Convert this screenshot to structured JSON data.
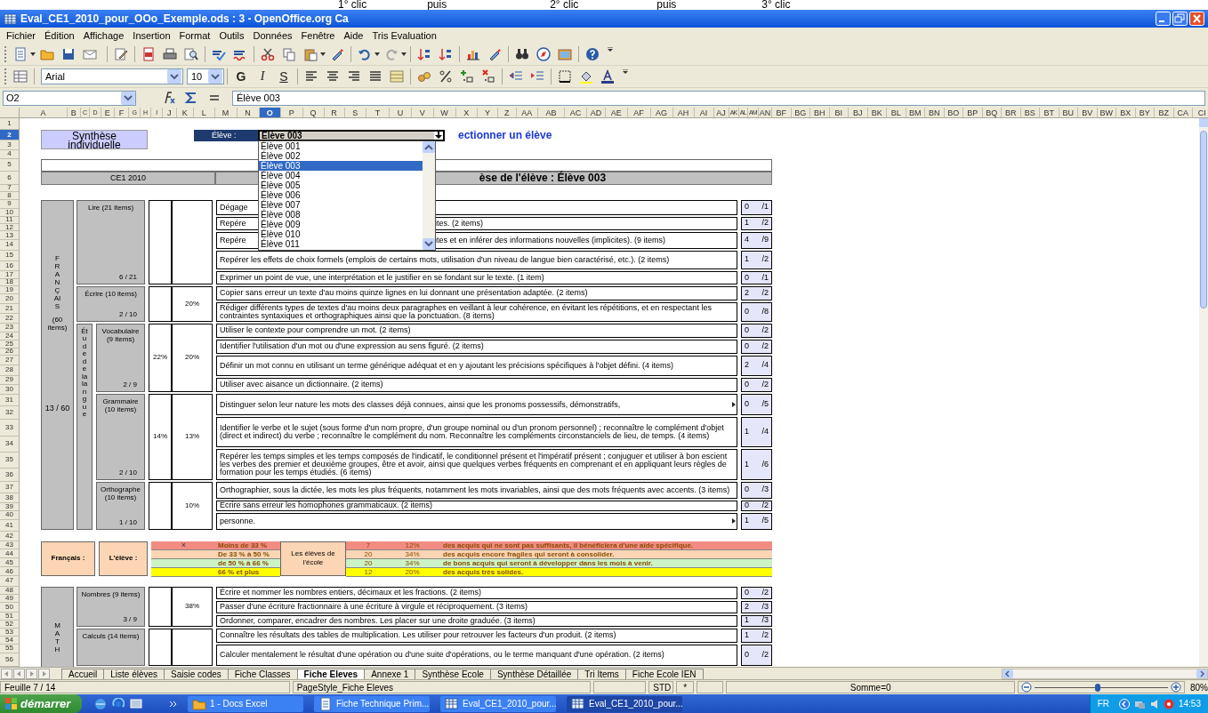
{
  "annotations": [
    "1° clic",
    "puis",
    "2° clic",
    "puis",
    "3° clic"
  ],
  "window": {
    "title": "Eval_CE1_2010_pour_OOo_Exemple.ods : 3 - OpenOffice.org Ca"
  },
  "menu": [
    "Fichier",
    "Édition",
    "Affichage",
    "Insertion",
    "Format",
    "Outils",
    "Données",
    "Fenêtre",
    "Aide",
    "Tris Evaluation"
  ],
  "format_toolbar": {
    "font_name": "Arial",
    "font_size": "10",
    "style_buttons": [
      "G",
      "I",
      "S"
    ]
  },
  "formula_bar": {
    "cell_ref": "O2",
    "content": "Élève 003"
  },
  "columns": [
    {
      "label": "A",
      "selected": false
    },
    {
      "label": "B",
      "selected": false
    },
    {
      "label": "C",
      "selected": false
    },
    {
      "label": "D",
      "selected": false
    },
    {
      "label": "E",
      "selected": false
    },
    {
      "label": "F",
      "selected": false
    },
    {
      "label": "G",
      "selected": false
    },
    {
      "label": "H",
      "selected": false
    },
    {
      "label": "I",
      "selected": false
    },
    {
      "label": "J",
      "selected": false
    },
    {
      "label": "K",
      "selected": false
    },
    {
      "label": "L",
      "selected": false
    },
    {
      "label": "M",
      "selected": false
    },
    {
      "label": "N",
      "selected": false
    },
    {
      "label": "O",
      "selected": true
    },
    {
      "label": "P",
      "selected": false
    },
    {
      "label": "Q",
      "selected": false
    },
    {
      "label": "R",
      "selected": false
    },
    {
      "label": "S",
      "selected": false
    },
    {
      "label": "T",
      "selected": false
    },
    {
      "label": "U",
      "selected": false
    },
    {
      "label": "V",
      "selected": false
    },
    {
      "label": "W",
      "selected": false
    },
    {
      "label": "X",
      "selected": false
    },
    {
      "label": "Y",
      "selected": false
    },
    {
      "label": "Z",
      "selected": false
    },
    {
      "label": "AA",
      "selected": false
    },
    {
      "label": "AB",
      "selected": false
    },
    {
      "label": "AC",
      "selected": false
    },
    {
      "label": "AD",
      "selected": false
    },
    {
      "label": "AE",
      "selected": false
    },
    {
      "label": "AF",
      "selected": false
    },
    {
      "label": "AG",
      "selected": false
    },
    {
      "label": "AH",
      "selected": false
    },
    {
      "label": "AI",
      "selected": false
    },
    {
      "label": "AJ",
      "selected": false
    },
    {
      "label": "AK",
      "selected": false
    },
    {
      "label": "AL",
      "selected": false
    },
    {
      "label": "AM",
      "selected": false
    },
    {
      "label": "AN",
      "selected": false
    },
    {
      "label": "BF",
      "selected": false
    },
    {
      "label": "BG",
      "selected": false
    },
    {
      "label": "BH",
      "selected": false
    },
    {
      "label": "BI",
      "selected": false
    },
    {
      "label": "BJ",
      "selected": false
    },
    {
      "label": "BK",
      "selected": false
    },
    {
      "label": "BL",
      "selected": false
    },
    {
      "label": "BM",
      "selected": false
    },
    {
      "label": "BN",
      "selected": false
    },
    {
      "label": "BO",
      "selected": false
    },
    {
      "label": "BP",
      "selected": false
    },
    {
      "label": "BQ",
      "selected": false
    },
    {
      "label": "BR",
      "selected": false
    },
    {
      "label": "BS",
      "selected": false
    },
    {
      "label": "BT",
      "selected": false
    },
    {
      "label": "BU",
      "selected": false
    },
    {
      "label": "BV",
      "selected": false
    },
    {
      "label": "BW",
      "selected": false
    },
    {
      "label": "BX",
      "selected": false
    },
    {
      "label": "BY",
      "selected": false
    },
    {
      "label": "BZ",
      "selected": false
    },
    {
      "label": "CA",
      "selected": false
    },
    {
      "label": "CI",
      "selected": false
    }
  ],
  "rows": [
    {
      "label": "1",
      "selected": false
    },
    {
      "label": "2",
      "selected": true
    },
    {
      "label": "3",
      "selected": false
    },
    {
      "label": "4",
      "selected": false
    },
    {
      "label": "5",
      "selected": false
    },
    {
      "label": "6",
      "selected": false
    },
    {
      "label": "7",
      "selected": false
    },
    {
      "label": "8",
      "selected": false
    },
    {
      "label": "9",
      "selected": false
    },
    {
      "label": "10",
      "selected": false
    },
    {
      "label": "11",
      "selected": false
    },
    {
      "label": "12",
      "selected": false
    },
    {
      "label": "13",
      "selected": false
    },
    {
      "label": "14",
      "selected": false
    },
    {
      "label": "15",
      "selected": false
    },
    {
      "label": "16",
      "selected": false
    },
    {
      "label": "17",
      "selected": false
    },
    {
      "label": "18",
      "selected": false
    },
    {
      "label": "19",
      "selected": false
    },
    {
      "label": "20",
      "selected": false
    },
    {
      "label": "21",
      "selected": false
    },
    {
      "label": "22",
      "selected": false
    },
    {
      "label": "23",
      "selected": false
    },
    {
      "label": "24",
      "selected": false
    },
    {
      "label": "25",
      "selected": false
    },
    {
      "label": "26",
      "selected": false
    },
    {
      "label": "27",
      "selected": false
    },
    {
      "label": "28",
      "selected": false
    },
    {
      "label": "29",
      "selected": false
    },
    {
      "label": "30",
      "selected": false
    },
    {
      "label": "31",
      "selected": false
    },
    {
      "label": "32",
      "selected": false
    },
    {
      "label": "33",
      "selected": false
    },
    {
      "label": "34",
      "selected": false
    },
    {
      "label": "35",
      "selected": false
    },
    {
      "label": "36",
      "selected": false
    },
    {
      "label": "37",
      "selected": false
    },
    {
      "label": "38",
      "selected": false
    },
    {
      "label": "39",
      "selected": false
    },
    {
      "label": "40",
      "selected": false
    },
    {
      "label": "41",
      "selected": false
    },
    {
      "label": "42",
      "selected": false
    },
    {
      "label": "43",
      "selected": false
    },
    {
      "label": "44",
      "selected": false
    },
    {
      "label": "45",
      "selected": false
    },
    {
      "label": "46",
      "selected": false
    },
    {
      "label": "47",
      "selected": false
    },
    {
      "label": "48",
      "selected": false
    },
    {
      "label": "49",
      "selected": false
    },
    {
      "label": "50",
      "selected": false
    },
    {
      "label": "51",
      "selected": false
    },
    {
      "label": "52",
      "selected": false
    },
    {
      "label": "53",
      "selected": false
    },
    {
      "label": "54",
      "selected": false
    },
    {
      "label": "55",
      "selected": false
    },
    {
      "label": "56",
      "selected": false
    }
  ],
  "sheet": {
    "header": {
      "title": "Synthèse individuelle",
      "student_label": "Élève :",
      "student_value": "Élève 003",
      "hint": "ectionner un élève",
      "class_label": "CE1 2010",
      "synthesis_title": "èse de l'élève : Élève 003"
    },
    "dropdown": {
      "options": [
        {
          "label": "Élève 001",
          "selected": false
        },
        {
          "label": "Élève 002",
          "selected": false
        },
        {
          "label": "Élève 003",
          "selected": true
        },
        {
          "label": "Élève 004",
          "selected": false
        },
        {
          "label": "Élève 005",
          "selected": false
        },
        {
          "label": "Élève 006",
          "selected": false
        },
        {
          "label": "Élève 007",
          "selected": false
        },
        {
          "label": "Élève 008",
          "selected": false
        },
        {
          "label": "Élève 009",
          "selected": false
        },
        {
          "label": "Élève 010",
          "selected": false
        },
        {
          "label": "Élève 011",
          "selected": false
        }
      ]
    },
    "francais": {
      "name": "FRANÇAIS",
      "count": "(60 items)",
      "score": "13 / 60",
      "groups": [
        {
          "kind": "group",
          "name": "Lire (21 items)",
          "score": "6 / 21",
          "items": [
            {
              "text": "Dégage",
              "score": "0",
              "max": "/1",
              "clipped": false
            },
            {
              "text": "Repére",
              "text_after": "ites. (2 items)",
              "score": "1",
              "max": "/2",
              "clipped": false
            },
            {
              "text": "Repére",
              "text_after": "ites et en inférer des informations nouvelles (implicites). (9 items)",
              "score": "4",
              "max": "/9",
              "clipped": false
            },
            {
              "text": "Repérer les effets de choix formels (emplois de certains mots, utilisation d'un niveau de langue bien caractérisé, etc.). (2 items)",
              "score": "1",
              "max": "/2",
              "clipped": false
            },
            {
              "text": "Exprimer un point de vue, une interprétation et le justifier en se fondant sur le texte. (1 item)",
              "score": "0",
              "max": "/1",
              "clipped": false
            }
          ]
        },
        {
          "kind": "group",
          "name": "Écrire (10 items)",
          "score": "2 / 10",
          "pct": "20%",
          "items": [
            {
              "text": "Copier sans erreur un texte d'au moins quinze lignes en lui donnant une présentation adaptée. (2 items)",
              "score": "2",
              "max": "/2",
              "clipped": false
            },
            {
              "text": "Rédiger différents types de textes d'au moins deux paragraphes en veillant à leur cohérence, en évitant les répétitions, et en respectant les contraintes syntaxiques et orthographiques ainsi que la ponctuation. (8 items)",
              "score": "0",
              "max": "/8",
              "clipped": false
            }
          ]
        },
        {
          "kind": "section",
          "name": "Étude de la langue",
          "subgroups": [
            {
              "name": "Vocabulaire (9 items)",
              "score": "2 / 9",
              "pct_outer": "22%",
              "pct": "20%",
              "items": [
                {
                  "text": "Utiliser le contexte pour comprendre un mot. (2 items)",
                  "score": "0",
                  "max": "/2",
                  "clipped": false
                },
                {
                  "text": "Identifier l'utilisation d'un mot ou d'une expression au sens figuré. (2 items)",
                  "score": "0",
                  "max": "/2",
                  "clipped": false
                },
                {
                  "text": "Définir un mot connu en utilisant un terme générique adéquat et en y ajoutant les précisions spécifiques à l'objet défini. (4 items)",
                  "score": "2",
                  "max": "/4",
                  "clipped": false
                },
                {
                  "text": "Utiliser avec aisance un dictionnaire. (2 items)",
                  "score": "0",
                  "max": "/2",
                  "clipped": false
                }
              ]
            },
            {
              "name": "Grammaire (10 items)",
              "score": "2 / 10",
              "pct_outer": "14%",
              "pct": "13%",
              "items": [
                {
                  "text": "Distinguer selon leur nature les mots des classes déjà connues, ainsi que les pronoms possessifs, démonstratifs,",
                  "score": "0",
                  "max": "/5",
                  "clipped": true
                },
                {
                  "text": "Identifier le verbe et le sujet (sous forme d'un nom propre, d'un groupe nominal ou d'un pronom personnel) ; reconnaître le complément d'objet (direct et indirect) du verbe ; reconnaître le complément du nom. Reconnaître les compléments circonstanciels de lieu, de temps. (4 items)",
                  "score": "1",
                  "max": "/4",
                  "clipped": false
                },
                {
                  "text": "Repérer les temps simples et les temps composés de l'indicatif, le conditionnel présent et l'impératif présent ; conjuguer et utiliser à bon escient les verbes des premier et deuxième groupes, être et avoir, ainsi que quelques verbes fréquents en comprenant et en appliquant leurs règles de formation pour les temps étudiés. (6 items)",
                  "score": "1",
                  "max": "/6",
                  "clipped": false
                }
              ]
            },
            {
              "name": "Orthographe (10 items)",
              "score": "1 / 10",
              "pct": "10%",
              "items": [
                {
                  "text": "Orthographier, sous la dictée, les mots les plus fréquents, notamment les mots invariables, ainsi que des mots fréquents avec accents. (3 items)",
                  "score": "0",
                  "max": "/3",
                  "clipped": false
                },
                {
                  "text": "Écrire sans erreur les homophones grammaticaux. (2 items)",
                  "score": "0",
                  "max": "/2",
                  "clipped": false
                },
                {
                  "text": "personne.",
                  "score": "1",
                  "max": "/5",
                  "clipped": true
                }
              ]
            }
          ]
        }
      ]
    },
    "legend": {
      "domain": "Français :",
      "student": "L'élève :",
      "marker": "×",
      "school": "Les élèves de l'école",
      "levels": [
        {
          "range": "Moins de 33 %",
          "count": "7",
          "pct": "12%",
          "text": "des acquis qui ne sont pas suffisants, il bénéficiera d'une aide spécifique.",
          "color": "#f28b82",
          "selected": true
        },
        {
          "range": "De 33 % à 50 %",
          "count": "20",
          "pct": "34%",
          "text": "des acquis encore fragiles qui seront à consolider.",
          "color": "#fcd5b4",
          "selected": false
        },
        {
          "range": "de 50 % à 66 %",
          "count": "20",
          "pct": "34%",
          "text": "de bons acquis qui seront à développer dans les mois à venir.",
          "color": "#ccf2c6",
          "selected": false
        },
        {
          "range": "66 % et plus",
          "count": "12",
          "pct": "20%",
          "text": "des acquis très solides.",
          "color": "#ffff00",
          "selected": false
        }
      ]
    },
    "maths": {
      "name": "MATH",
      "groups": [
        {
          "kind": "group",
          "name": "Nombres (9 items)",
          "score": "3 / 9",
          "pct": "38%",
          "items": [
            {
              "text": "Écrire et nommer les nombres entiers, décimaux et les fractions. (2 items)",
              "score": "0",
              "max": "/2",
              "clipped": false
            },
            {
              "text": "Passer d'une écriture fractionnaire à une écriture à virgule et réciproquement. (3 items)",
              "score": "2",
              "max": "/3",
              "clipped": false
            },
            {
              "text": "Ordonner, comparer, encadrer des nombres. Les placer sur une droite graduée. (3 items)",
              "score": "1",
              "max": "/3",
              "clipped": false
            }
          ]
        },
        {
          "kind": "group",
          "name": "Calculs (14 items)",
          "items": [
            {
              "text": "Connaître les résultats des tables de multiplication. Les utiliser pour retrouver les facteurs d'un produit. (2 items)",
              "score": "1",
              "max": "/2",
              "clipped": false
            },
            {
              "text": "Calculer mentalement le résultat d'une opération ou d'une suite d'opérations, ou le terme manquant d'une opération. (2 items)",
              "score": "0",
              "max": "/2",
              "clipped": false
            }
          ]
        }
      ]
    }
  },
  "sheet_tabs": [
    {
      "label": "Accueil",
      "selected": false
    },
    {
      "label": "Liste élèves",
      "selected": false
    },
    {
      "label": "Saisie codes",
      "selected": false
    },
    {
      "label": "Fiche Classes",
      "selected": false
    },
    {
      "label": "Fiche Eleves",
      "selected": true
    },
    {
      "label": "Annexe 1",
      "selected": false
    },
    {
      "label": "Synthèse Ecole",
      "selected": false
    },
    {
      "label": "Synthèse Détaillée",
      "selected": false
    },
    {
      "label": "Tri Items",
      "selected": false
    },
    {
      "label": "Fiche Ecole IEN",
      "selected": false
    }
  ],
  "status_bar": {
    "sheet": "Feuille 7 / 14",
    "page_style": "PageStyle_Fiche Eleves",
    "mode": "STD",
    "modified": "*",
    "sum": "Somme=0",
    "zoom": "80%",
    "zoom_slider": {
      "level": 0.47
    }
  },
  "taskbar": {
    "start": "démarrer",
    "windows": [
      {
        "label": "1 - Docs Excel",
        "kind": "folder",
        "selected": false
      },
      {
        "label": "Fiche Technique Prim...",
        "kind": "doc",
        "selected": false
      },
      {
        "label": "Eval_CE1_2010_pour...",
        "kind": "calc",
        "selected": false
      },
      {
        "label": "Eval_CE1_2010_pour...",
        "kind": "calc",
        "selected": true
      }
    ],
    "language": "FR",
    "clock": "14:53"
  }
}
